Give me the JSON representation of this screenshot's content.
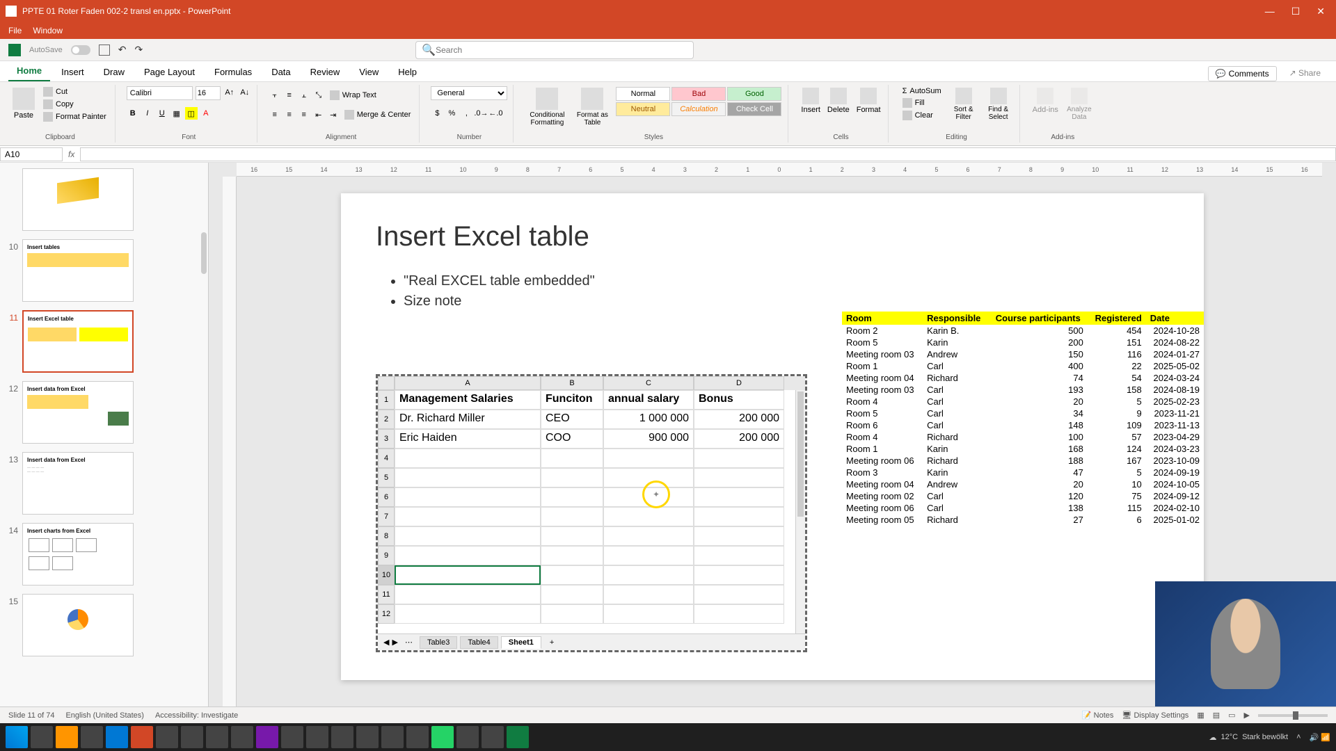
{
  "titlebar": {
    "title": "PPTE 01 Roter Faden 002-2 transl en.pptx - PowerPoint"
  },
  "menubar": {
    "file": "File",
    "window": "Window"
  },
  "qat": {
    "autosave": "AutoSave",
    "search_placeholder": "Search"
  },
  "tabs": {
    "items": [
      "Home",
      "Insert",
      "Draw",
      "Page Layout",
      "Formulas",
      "Data",
      "Review",
      "View",
      "Help"
    ],
    "comments": "Comments",
    "share": "Share"
  },
  "ribbon": {
    "clipboard": {
      "paste": "Paste",
      "cut": "Cut",
      "copy": "Copy",
      "format_painter": "Format Painter",
      "label": "Clipboard"
    },
    "font": {
      "name": "Calibri",
      "size": "16",
      "label": "Font"
    },
    "alignment": {
      "wrap": "Wrap Text",
      "merge": "Merge & Center",
      "label": "Alignment"
    },
    "number": {
      "format": "General",
      "label": "Number"
    },
    "styles": {
      "cond": "Conditional Formatting",
      "fat": "Format as Table",
      "normal": "Normal",
      "bad": "Bad",
      "good": "Good",
      "neutral": "Neutral",
      "calc": "Calculation",
      "check": "Check Cell",
      "label": "Styles"
    },
    "cells": {
      "insert": "Insert",
      "delete": "Delete",
      "format": "Format",
      "label": "Cells"
    },
    "editing": {
      "autosum": "AutoSum",
      "fill": "Fill",
      "clear": "Clear",
      "sort": "Sort & Filter",
      "find": "Find & Select",
      "label": "Editing"
    },
    "addins": {
      "addins": "Add-ins",
      "analyze": "Analyze Data",
      "label": "Add-ins"
    }
  },
  "namebox": {
    "ref": "A10",
    "fx": "fx"
  },
  "ruler": [
    "16",
    "15",
    "14",
    "13",
    "12",
    "11",
    "10",
    "9",
    "8",
    "7",
    "6",
    "5",
    "4",
    "3",
    "2",
    "1",
    "0",
    "1",
    "2",
    "3",
    "4",
    "5",
    "6",
    "7",
    "8",
    "9",
    "10",
    "11",
    "12",
    "13",
    "14",
    "15",
    "16"
  ],
  "thumbnails": [
    {
      "num": "",
      "title": ""
    },
    {
      "num": "10",
      "title": "Insert tables"
    },
    {
      "num": "11",
      "title": "Insert Excel table"
    },
    {
      "num": "12",
      "title": "Insert data from Excel"
    },
    {
      "num": "13",
      "title": "Insert data from Excel"
    },
    {
      "num": "14",
      "title": "Insert charts from Excel"
    },
    {
      "num": "15",
      "title": ""
    }
  ],
  "slide": {
    "title": "Insert Excel table",
    "bullet1": "\"Real EXCEL table embedded\"",
    "bullet2": "Size note"
  },
  "embed": {
    "cols": [
      "A",
      "B",
      "C",
      "D"
    ],
    "headers": {
      "a": "Management Salaries",
      "b": "Funciton",
      "c": "annual salary",
      "d": "Bonus"
    },
    "rows": [
      {
        "a": "Dr. Richard Miller",
        "b": "CEO",
        "c": "1 000 000",
        "d": "200 000"
      },
      {
        "a": "Eric Haiden",
        "b": "COO",
        "c": "900 000",
        "d": "200 000"
      }
    ],
    "sheets": {
      "t3": "Table3",
      "t4": "Table4",
      "s1": "Sheet1"
    }
  },
  "right_table": {
    "headers": {
      "room": "Room",
      "resp": "Responsible",
      "part": "Course participants",
      "reg": "Registered",
      "date": "Date"
    },
    "rows": [
      [
        "Room 2",
        "Karin B.",
        "500",
        "454",
        "2024-10-28"
      ],
      [
        "Room 5",
        "Karin",
        "200",
        "151",
        "2024-08-22"
      ],
      [
        "Meeting room 03",
        "Andrew",
        "150",
        "116",
        "2024-01-27"
      ],
      [
        "Room 1",
        "Carl",
        "400",
        "22",
        "2025-05-02"
      ],
      [
        "Meeting room 04",
        "Richard",
        "74",
        "54",
        "2024-03-24"
      ],
      [
        "Meeting room 03",
        "Carl",
        "193",
        "158",
        "2024-08-19"
      ],
      [
        "Room 4",
        "Carl",
        "20",
        "5",
        "2025-02-23"
      ],
      [
        "Room 5",
        "Carl",
        "34",
        "9",
        "2023-11-21"
      ],
      [
        "Room 6",
        "Carl",
        "148",
        "109",
        "2023-11-13"
      ],
      [
        "Room 4",
        "Richard",
        "100",
        "57",
        "2023-04-29"
      ],
      [
        "Room 1",
        "Karin",
        "168",
        "124",
        "2024-03-23"
      ],
      [
        "Meeting room 06",
        "Richard",
        "188",
        "167",
        "2023-10-09"
      ],
      [
        "Room 3",
        "Karin",
        "47",
        "5",
        "2024-09-19"
      ],
      [
        "Meeting room 04",
        "Andrew",
        "20",
        "10",
        "2024-10-05"
      ],
      [
        "Meeting room 02",
        "Carl",
        "120",
        "75",
        "2024-09-12"
      ],
      [
        "Meeting room 06",
        "Carl",
        "138",
        "115",
        "2024-02-10"
      ],
      [
        "Meeting room 05",
        "Richard",
        "27",
        "6",
        "2025-01-02"
      ]
    ]
  },
  "statusbar": {
    "slide": "Slide 11 of 74",
    "lang": "English (United States)",
    "access": "Accessibility: Investigate",
    "notes": "Notes",
    "display": "Display Settings"
  },
  "taskbar": {
    "weather_temp": "12°C",
    "weather_desc": "Stark bewölkt"
  }
}
